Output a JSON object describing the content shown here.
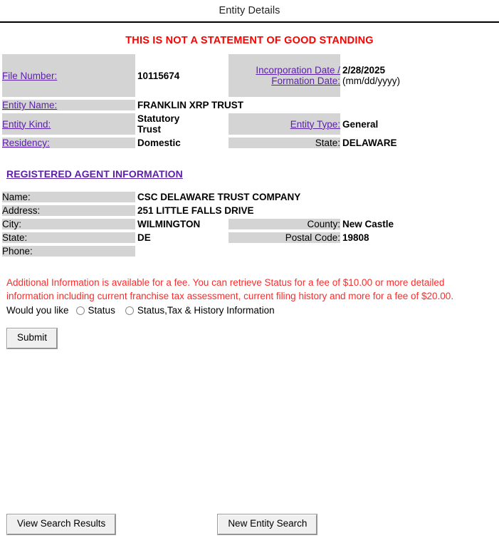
{
  "header": {
    "title": "Entity Details"
  },
  "warning": {
    "text": "THIS IS NOT A STATEMENT OF GOOD STANDING"
  },
  "entity": {
    "rows": [
      {
        "label1": "File Number:",
        "value1": "10115674",
        "label2": "Incorporation Date /\nFormation Date:",
        "value2": "2/28/2025",
        "value2_sub": "(mm/dd/yyyy)"
      },
      {
        "label1": "Entity Name:",
        "value1": "FRANKLIN XRP TRUST",
        "label2": "",
        "value2": "",
        "value2_sub": ""
      },
      {
        "label1": "Entity Kind:",
        "value1": "Statutory\nTrust",
        "label2": "Entity Type:",
        "value2": "General",
        "value2_sub": ""
      },
      {
        "label1": "Residency:",
        "value1": "Domestic",
        "label2": "State:",
        "value2": "DELAWARE",
        "value2_sub": ""
      }
    ]
  },
  "agent_section": {
    "heading": "REGISTERED AGENT INFORMATION",
    "rows": [
      {
        "label1": "Name:",
        "value1": "CSC DELAWARE TRUST COMPANY",
        "label2": "",
        "value2": ""
      },
      {
        "label1": "Address:",
        "value1": "251 LITTLE FALLS DRIVE",
        "label2": "",
        "value2": ""
      },
      {
        "label1": "City:",
        "value1": "WILMINGTON",
        "label2": "County:",
        "value2": "New Castle"
      },
      {
        "label1": "State:",
        "value1": "DE",
        "label2": "Postal Code:",
        "value2": "19808"
      },
      {
        "label1": "Phone:",
        "value1": "",
        "label2": "",
        "value2": ""
      }
    ]
  },
  "fee_notice": {
    "text": "Additional Information is available for a fee. You can retrieve Status for a fee of $10.00 or more detailed information including current franchise tax assessment, current filing history and more for a fee of $20.00."
  },
  "options": {
    "lead_text": "Would you like",
    "radio_status_label": "Status",
    "radio_full_label": "Status,Tax & History Information",
    "status_selected": false,
    "full_selected": false
  },
  "buttons": {
    "submit": "Submit",
    "view_search_results": "View Search Results",
    "new_entity_search": "New Entity Search"
  },
  "colors": {
    "warning_red": "#ff0000",
    "notice_red": "#ff2a2a",
    "link_purple": "#5b1fa8",
    "cell_grey": "#d4d4d4"
  }
}
